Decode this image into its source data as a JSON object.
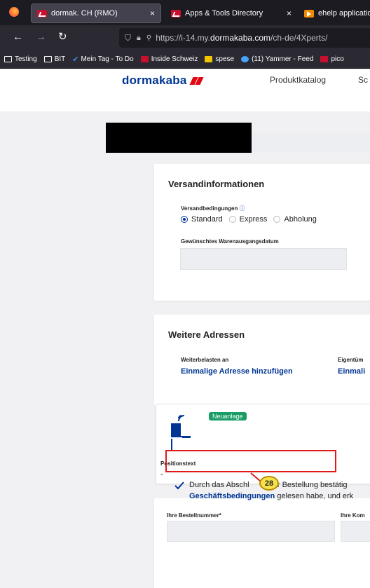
{
  "browser": {
    "tabs": [
      {
        "label": "dormak. CH (RMO)",
        "close": "×",
        "active": true
      },
      {
        "label": "Apps & Tools Directory",
        "close": "×",
        "active": false
      },
      {
        "label": "ehelp applicatio",
        "close": "",
        "active": false
      }
    ],
    "url_prefix": "https://i-14.my.",
    "url_domain": "dormakaba.com",
    "url_suffix": "/ch-de/4Xperts/",
    "bookmarks": [
      "Testing",
      "BIT",
      "Mein Tag - To Do",
      "Inside Schweiz",
      "spese",
      "(11) Yammer - Feed",
      "pico"
    ]
  },
  "site": {
    "logo": "dormakaba",
    "nav": [
      "Produktkatalog",
      "Sc"
    ]
  },
  "shipping": {
    "title": "Versandinformationen",
    "conditions_label": "Versandbedingungen",
    "info_icon": "ⓘ",
    "options": [
      "Standard",
      "Express",
      "Abholung"
    ],
    "selected": "Standard",
    "date_label": "Gewünschtes Warenausgangsdatum",
    "date_value": ""
  },
  "addresses": {
    "title": "Weitere Adressen",
    "col1_label": "Weiterbelasten an",
    "col1_link": "Einmalige Adresse hinzufügen",
    "col2_label": "Eigentüm",
    "col2_link": "Einmali"
  },
  "position": {
    "badge": "Neuanlage",
    "label": "Positionstext",
    "value": "-"
  },
  "order": {
    "number_label": "Ihre Bestellnummer*",
    "number_value": "",
    "commission_label": "Ihre Kom",
    "terms_prefix": "Durch das Abschl",
    "terms_middle": "der Bestellung bestätig",
    "terms_link": "Geschäftsbedingungen",
    "terms_suffix": " gelesen habe, und erk",
    "terms_checked": true
  },
  "annotation": {
    "marker_number": "28",
    "highlight_color": "#e01a1a"
  }
}
